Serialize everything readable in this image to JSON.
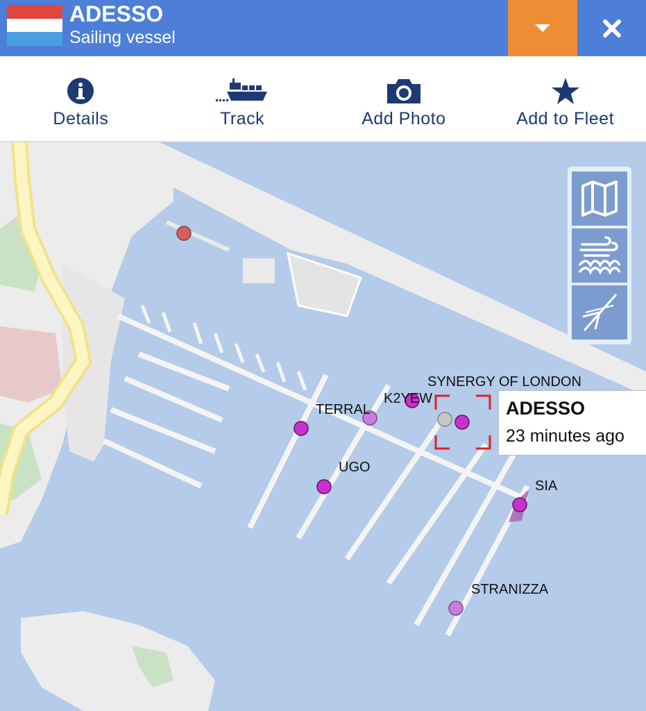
{
  "header": {
    "vessel_name": "ADESSO",
    "vessel_type": "Sailing vessel",
    "flag": "netherlands-flag",
    "colors": {
      "bar": "#4d7fd8",
      "dropdown": "#ee8d34"
    }
  },
  "toolbar": {
    "items": [
      {
        "label": "Details",
        "icon": "info-icon"
      },
      {
        "label": "Track",
        "icon": "ship-track-icon"
      },
      {
        "label": "Add Photo",
        "icon": "camera-icon"
      },
      {
        "label": "Add to Fleet",
        "icon": "star-icon"
      }
    ]
  },
  "map": {
    "vessel_labels": [
      "SYNERGY OF LONDON",
      "K2YEW",
      "TERRAL",
      "UGO",
      "SIA",
      "STRANIZZA"
    ],
    "layer_buttons": [
      "map-layers-icon",
      "weather-icon",
      "measure-icon"
    ],
    "popup": {
      "name": "ADESSO",
      "time": "23 minutes ago"
    }
  }
}
